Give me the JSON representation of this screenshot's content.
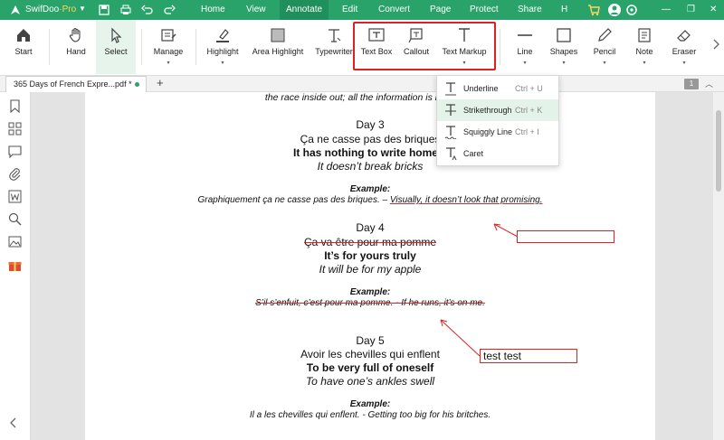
{
  "app": {
    "name": "SwifDoo",
    "suffix": "·Pro",
    "dropdown": "▼"
  },
  "menu": [
    {
      "label": "Home"
    },
    {
      "label": "View"
    },
    {
      "label": "Annotate"
    },
    {
      "label": "Edit"
    },
    {
      "label": "Convert"
    },
    {
      "label": "Page"
    },
    {
      "label": "Protect"
    },
    {
      "label": "Share"
    },
    {
      "label": "H"
    }
  ],
  "active_menu": "Annotate",
  "window_controls": {
    "minimize": "—",
    "restore": "❐",
    "close": "✕"
  },
  "toolbar": [
    {
      "label": "Start",
      "icon": "home-icon"
    },
    {
      "label": "Hand",
      "icon": "hand-icon"
    },
    {
      "label": "Select",
      "icon": "cursor-icon"
    },
    {
      "label": "Manage",
      "icon": "manage-icon"
    },
    {
      "label": "Highlight",
      "icon": "highlight-icon"
    },
    {
      "label": "Area Highlight",
      "icon": "area-highlight-icon"
    },
    {
      "label": "Typewriter",
      "icon": "typewriter-icon"
    },
    {
      "label": "Text Box",
      "icon": "text-box-icon"
    },
    {
      "label": "Callout",
      "icon": "callout-icon"
    },
    {
      "label": "Text Markup",
      "icon": "text-markup-icon"
    },
    {
      "label": "Line",
      "icon": "line-icon"
    },
    {
      "label": "Shapes",
      "icon": "shapes-icon"
    },
    {
      "label": "Pencil",
      "icon": "pencil-icon"
    },
    {
      "label": "Note",
      "icon": "note-icon"
    },
    {
      "label": "Eraser",
      "icon": "eraser-icon"
    }
  ],
  "caret": "▾",
  "tab": {
    "name": "365 Days of French Expre...pdf *",
    "add": "+"
  },
  "page_number": "1",
  "page_up": "︿",
  "dropdown": [
    {
      "label": "Underline",
      "shortcut": "Ctrl + U",
      "icon": "underline-icon"
    },
    {
      "label": "Strikethrough",
      "shortcut": "Ctrl + K",
      "icon": "strikethrough-icon"
    },
    {
      "label": "Squiggly Line",
      "shortcut": "Ctrl + I",
      "icon": "squiggly-line-icon"
    },
    {
      "label": "Caret",
      "shortcut": "",
      "icon": "caret-icon"
    }
  ],
  "document": {
    "top_line": "the race inside out; all the information is here right",
    "entries": [
      {
        "day": "Day 3",
        "french": "Ça ne casse pas des briques",
        "meaning": "It has nothing to write home a",
        "literal": "It doesn’t break bricks",
        "example_label": "Example:",
        "example_fr": "Graphiquement ça ne casse pas des briques. – ",
        "example_en": "Visually, it doesn’t look that promising."
      },
      {
        "day": "Day 4",
        "french": "Ça va être pour ma pomme",
        "meaning": "It’s for yours truly",
        "literal": "It will be for my apple",
        "example_label": "Example:",
        "example": "S’il s’enfuit, c’est pour ma pomme. - If he runs, it’s on me."
      },
      {
        "day": "Day 5",
        "french": "Avoir les chevilles qui enflent",
        "meaning": "To be very full of oneself",
        "literal": "To have one’s ankles swell",
        "example_label": "Example:",
        "example": "Il a les chevilles qui enflent. - Getting too big for his britches."
      }
    ],
    "callouts": [
      {
        "text": ""
      },
      {
        "text": "test test"
      }
    ]
  },
  "colors": {
    "brand": "#2aa36b",
    "annotation": "#d22222",
    "highlight_box": "#e02020"
  }
}
